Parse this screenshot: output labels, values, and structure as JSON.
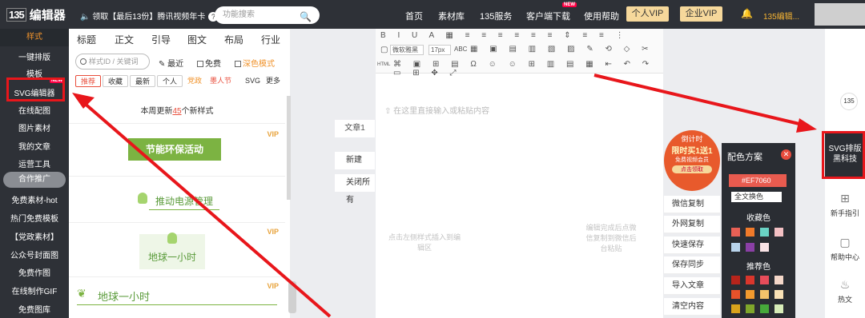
{
  "topbar": {
    "logo_mark": "135",
    "logo_text": "编辑器",
    "notice": "🔈 领取【最后13份】腾讯视频年卡",
    "search_placeholder": "功能搜索",
    "nav": [
      "首页",
      "素材库",
      "135服务",
      "客户端下载",
      "使用帮助"
    ],
    "new_tag": "NEW",
    "vip_personal": "个人VIP",
    "vip_enterprise": "企业VIP",
    "user": "135编辑..."
  },
  "sidebar": {
    "items": [
      "样式",
      "一键排版",
      "模板",
      "SVG编辑器",
      "在线配图",
      "图片素材",
      "我的文章",
      "运营工具",
      "合作推广",
      "免费素材-hot",
      "热门免费模板",
      "【党政素材】",
      "公众号封面图",
      "免费作图",
      "在线制作GIF",
      "免费图库"
    ],
    "svg_new": "NEW"
  },
  "panel": {
    "tabs": [
      "标题",
      "正文",
      "引导",
      "图文",
      "布局",
      "行业"
    ],
    "keyword_placeholder": "样式ID / 关键词",
    "recent": "最近",
    "free": "免费",
    "dark": "深色模式",
    "subtabs": [
      "推荐",
      "收藏",
      "最新",
      "个人",
      "党政",
      "墨人节",
      "SVG",
      "更多"
    ],
    "update_prefix": "本周更新",
    "update_count": "45",
    "update_suffix": "个新样式",
    "vip": "VIP",
    "cards": [
      "节能环保活动",
      "推动电源管理",
      "地球一小时",
      "地球一小时"
    ]
  },
  "middle": {
    "article": "文章1",
    "new": "新建",
    "close_all": "关闭所有",
    "placeholder": "在这里直接输入或粘贴内容",
    "hint_left": "点击左侧样式插入到编辑区",
    "hint_right": "编辑完成后点微信复制到微信后台粘贴",
    "font": "微软雅黑",
    "size": "17px",
    "abc": "ABC",
    "html": "HTML"
  },
  "right": {
    "promo": [
      "倒计时",
      "限时买1送1",
      "免费视频会员",
      "点击领取"
    ],
    "buttons": [
      "微信复制",
      "外网复制",
      "快速保存",
      "保存同步",
      "导入文章",
      "清空内容"
    ],
    "cs_title": "配色方案",
    "cs_color": "#EF7060",
    "cs_select": "全文换色",
    "collect": "收藏色",
    "recommend": "推荐色",
    "svgtech": "SVG排版黑科技",
    "guide": "新手指引",
    "help": "帮助中心",
    "hot": "热文",
    "logo": "135"
  },
  "colors": {
    "accent": "#e94e3c",
    "dark": "#2e3137",
    "vip": "#f6d89b",
    "green": "#7cb342"
  }
}
